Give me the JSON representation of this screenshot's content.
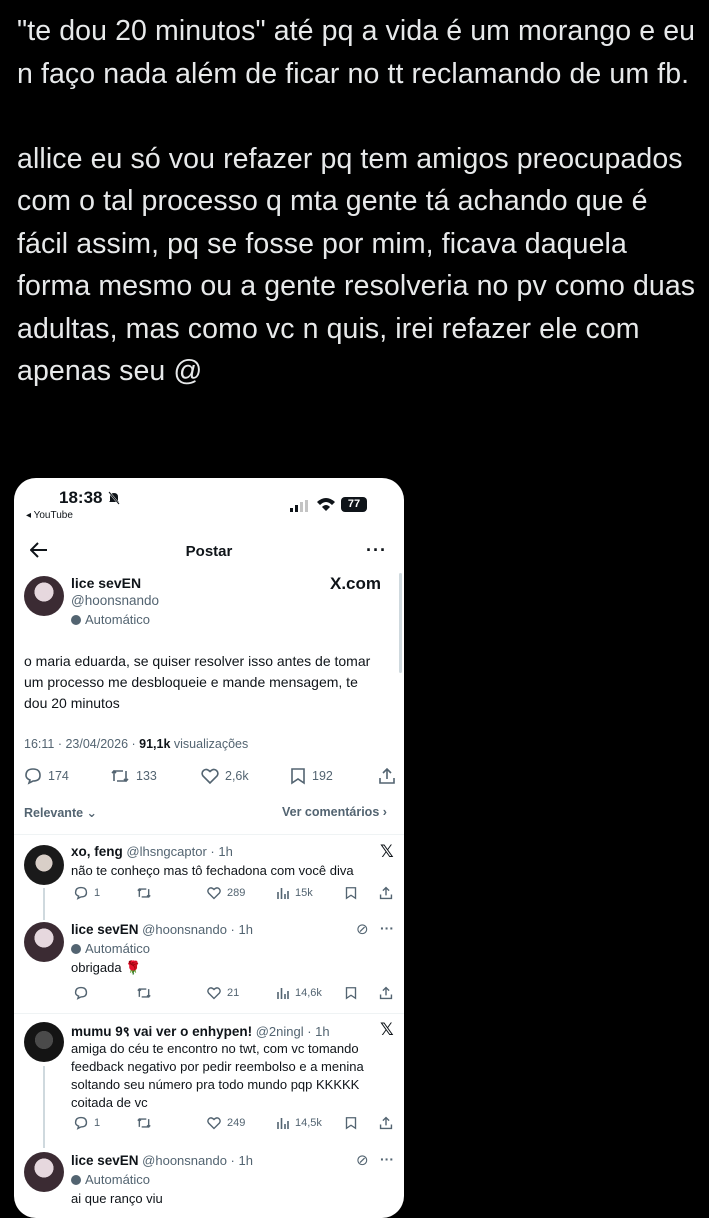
{
  "tweet": {
    "text": "\"te dou 20 minutos\" até pq a vida é um morango e eu n faço nada além de ficar no tt reclamando de um fb.\n\nallice eu só vou refazer pq tem amigos preocupados com o tal processo q mta gente tá achando que é fácil assim, pq se fosse por mim, ficava daquela forma mesmo ou a gente resolveria no pv como duas adultas, mas como vc n quis, irei refazer ele com apenas seu @"
  },
  "screenshot": {
    "status": {
      "time": "18:38",
      "back_app": "◂ YouTube",
      "battery": "77"
    },
    "header": {
      "title": "Postar"
    },
    "post": {
      "name": "lice sevEN",
      "handle": "@hoonsnando",
      "automated": "Automático",
      "logo": "X.com",
      "text": "o maria eduarda, se quiser resolver isso antes de tomar um processo me desbloqueie e mande mensagem, te dou 20 minutos",
      "meta_time": "16:11 · 23/04/2026 · ",
      "meta_views": "91,1k",
      "meta_views_label": " visualizações",
      "replies": "174",
      "retweets": "133",
      "likes": "2,6k",
      "bookmarks": "192"
    },
    "sort": {
      "label": "Relevante",
      "right": "Ver comentários"
    },
    "replies": [
      {
        "name": "xo, feng",
        "handle": "@lhsngcaptor · 1h",
        "text": "não te conheço mas tô fechadona com você diva",
        "replies": "1",
        "likes": "289",
        "views": "15k"
      },
      {
        "name": "lice sevEN",
        "handle": "@hoonsnando · 1h",
        "automated": "Automático",
        "text": "obrigada 🌹",
        "likes": "21",
        "views": "14,6k"
      },
      {
        "name": "mumu 9९ vai ver o enhypen!",
        "handle": "@2ningl · 1h",
        "text": "amiga do céu te encontro no twt, com vc tomando feedback negativo por pedir reembolso e a menina soltando seu número pra todo mundo pqp KKKKK coitada de vc",
        "replies": "1",
        "likes": "249",
        "views": "14,5k"
      },
      {
        "name": "lice sevEN",
        "handle": "@hoonsnando · 1h",
        "automated": "Automático",
        "text": "ai que ranço viu"
      }
    ],
    "colors": {
      "text": "#0f1419",
      "muted": "#536471",
      "divider": "#eff3f4",
      "page_bg": "#000000"
    }
  }
}
